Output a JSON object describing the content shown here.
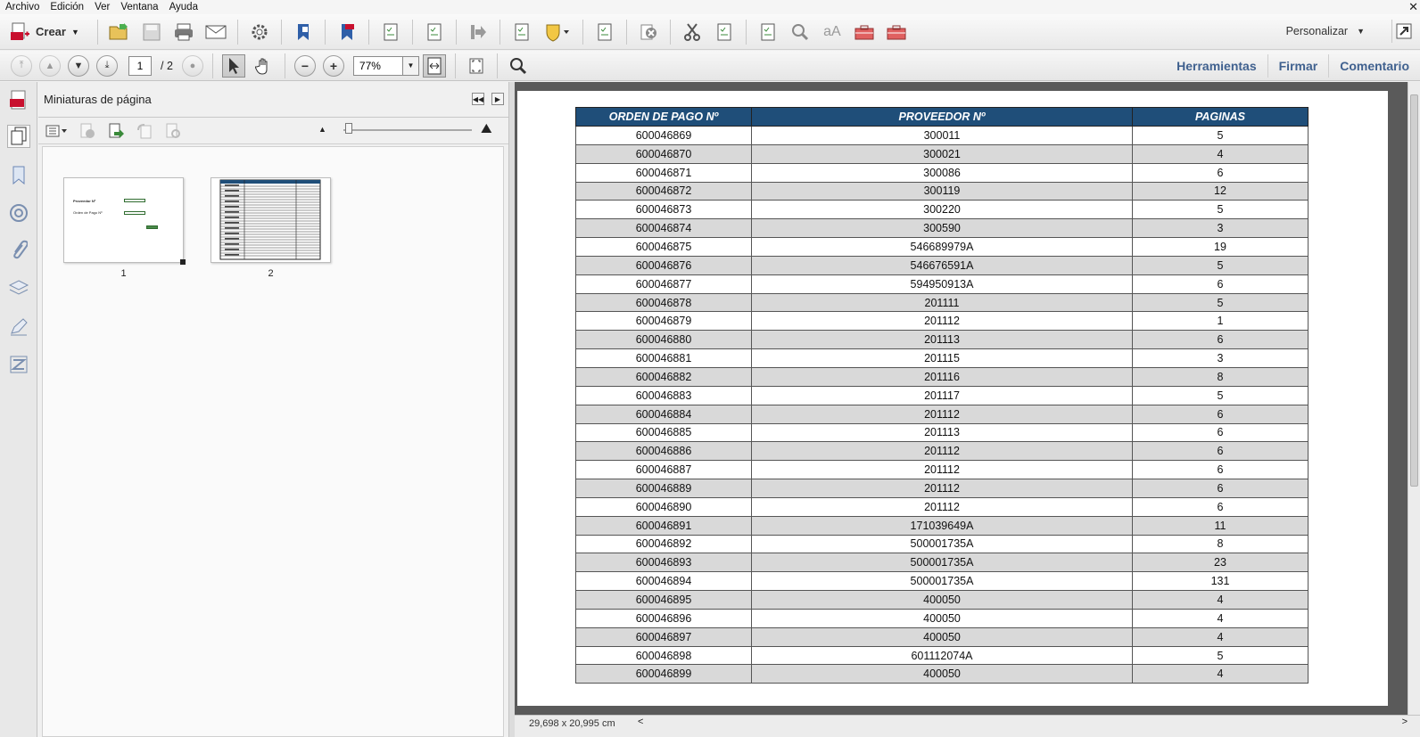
{
  "menu": [
    "Archivo",
    "Edición",
    "Ver",
    "Ventana",
    "Ayuda"
  ],
  "toolbar": {
    "crear_label": "Crear",
    "personalizar_label": "Personalizar"
  },
  "nav": {
    "page_value": "1",
    "page_total": "/ 2",
    "zoom_value": "77%"
  },
  "right_tabs": [
    "Herramientas",
    "Firmar",
    "Comentario"
  ],
  "panel": {
    "title": "Miniaturas de página",
    "thumb1_label": "1",
    "thumb2_label": "2",
    "thumb1_text_a": "Proveedor Nº",
    "thumb1_text_b": "Orden de Pago Nº"
  },
  "status": {
    "page_size": "29,698 x 20,995 cm"
  },
  "table": {
    "headers": [
      "ORDEN DE PAGO Nº",
      "PROVEEDOR Nº",
      "PAGINAS"
    ],
    "rows": [
      [
        "600046869",
        "300011",
        "5"
      ],
      [
        "600046870",
        "300021",
        "4"
      ],
      [
        "600046871",
        "300086",
        "6"
      ],
      [
        "600046872",
        "300119",
        "12"
      ],
      [
        "600046873",
        "300220",
        "5"
      ],
      [
        "600046874",
        "300590",
        "3"
      ],
      [
        "600046875",
        "546689979A",
        "19"
      ],
      [
        "600046876",
        "546676591A",
        "5"
      ],
      [
        "600046877",
        "594950913A",
        "6"
      ],
      [
        "600046878",
        "201111",
        "5"
      ],
      [
        "600046879",
        "201112",
        "1"
      ],
      [
        "600046880",
        "201113",
        "6"
      ],
      [
        "600046881",
        "201115",
        "3"
      ],
      [
        "600046882",
        "201116",
        "8"
      ],
      [
        "600046883",
        "201117",
        "5"
      ],
      [
        "600046884",
        "201112",
        "6"
      ],
      [
        "600046885",
        "201113",
        "6"
      ],
      [
        "600046886",
        "201112",
        "6"
      ],
      [
        "600046887",
        "201112",
        "6"
      ],
      [
        "600046889",
        "201112",
        "6"
      ],
      [
        "600046890",
        "201112",
        "6"
      ],
      [
        "600046891",
        "171039649A",
        "11"
      ],
      [
        "600046892",
        "500001735A",
        "8"
      ],
      [
        "600046893",
        "500001735A",
        "23"
      ],
      [
        "600046894",
        "500001735A",
        "131"
      ],
      [
        "600046895",
        "400050",
        "4"
      ],
      [
        "600046896",
        "400050",
        "4"
      ],
      [
        "600046897",
        "400050",
        "4"
      ],
      [
        "600046898",
        "601112074A",
        "5"
      ],
      [
        "600046899",
        "400050",
        "4"
      ]
    ]
  },
  "colors": {
    "header_bg": "#1f4e79",
    "stripe": "#d9d9d9",
    "tab_text": "#40618f"
  }
}
